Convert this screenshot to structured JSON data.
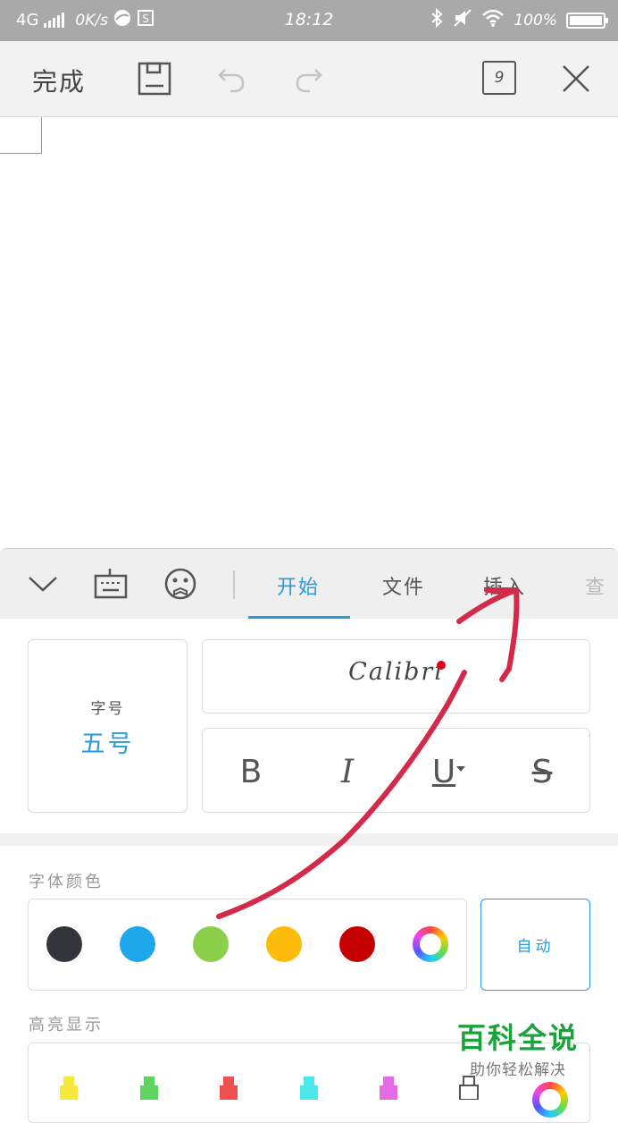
{
  "status_bar": {
    "network": "4G",
    "speed": "0K/s",
    "time": "18:12",
    "battery": "100%"
  },
  "toolbar": {
    "done_label": "完成",
    "page_count": "9"
  },
  "ribbon": {
    "tabs": [
      {
        "label": "开始",
        "active": true
      },
      {
        "label": "文件",
        "active": false
      },
      {
        "label": "插入",
        "active": false
      },
      {
        "label": "查",
        "active": false
      }
    ]
  },
  "font_panel": {
    "size_label": "字号",
    "size_value": "五号",
    "font_name": "Calibri",
    "format_buttons": [
      "B",
      "I",
      "U",
      "S"
    ]
  },
  "font_color": {
    "label": "字体颜色",
    "swatches": [
      "#33353b",
      "#1ea7ea",
      "#8bcf4b",
      "#fdbc0b",
      "#c40000"
    ],
    "auto_label": "自动"
  },
  "highlight": {
    "label": "高亮显示",
    "colors": [
      "#f6e93c",
      "#5ed45e",
      "#f05050",
      "#4de8ea",
      "#e66be6"
    ]
  },
  "watermark": {
    "title": "百科全说",
    "subtitle": "助你轻松解决"
  },
  "colors": {
    "accent": "#2a9ad9",
    "status_bar": "#a9a9a9",
    "annotation": "#d42a4a"
  }
}
